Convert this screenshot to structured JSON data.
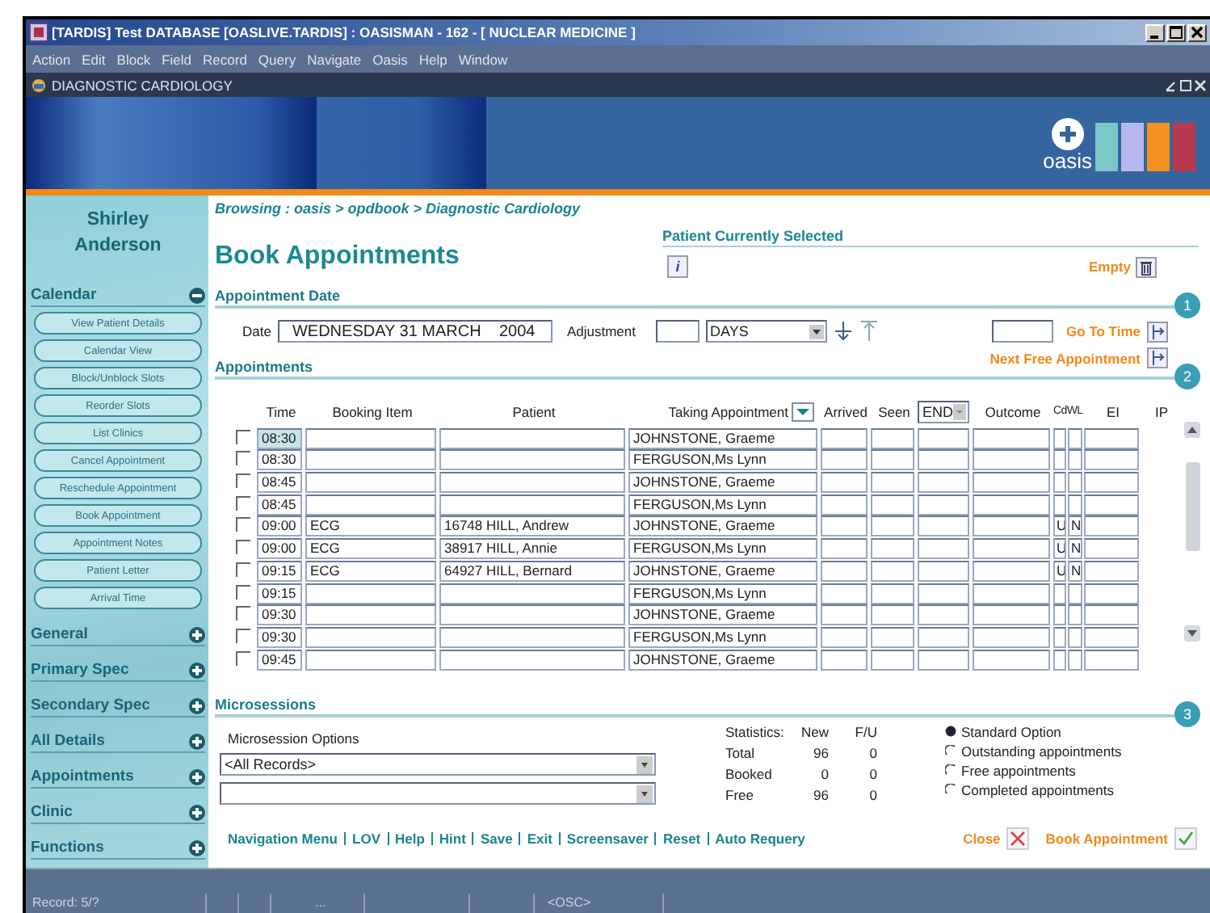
{
  "window": {
    "title": "[TARDIS] Test DATABASE [OASLIVE.TARDIS] : OASISMAN - 162 - [ NUCLEAR MEDICINE ]"
  },
  "menu": [
    "Action",
    "Edit",
    "Block",
    "Field",
    "Record",
    "Query",
    "Navigate",
    "Oasis",
    "Help",
    "Window"
  ],
  "subwindow": {
    "title": "DIAGNOSTIC CARDIOLOGY"
  },
  "logo": {
    "text": "oasis"
  },
  "sidebar": {
    "user": [
      "Shirley",
      "Anderson"
    ],
    "sections": [
      {
        "label": "Calendar",
        "expanded": true,
        "children": [
          "View Patient Details",
          "Calendar View",
          "Block/Unblock Slots",
          "Reorder Slots",
          "List Clinics",
          "Cancel Appointment",
          "Reschedule Appointment",
          "Book Appointment",
          "Appointment Notes",
          "Patient Letter",
          "Arrival Time"
        ]
      },
      {
        "label": "General",
        "expanded": false
      },
      {
        "label": "Primary Spec",
        "expanded": false
      },
      {
        "label": "Secondary Spec",
        "expanded": false
      },
      {
        "label": "All Details",
        "expanded": false
      },
      {
        "label": "Appointments",
        "expanded": false
      },
      {
        "label": "Clinic",
        "expanded": false
      },
      {
        "label": "Functions",
        "expanded": false
      }
    ]
  },
  "breadcrumb": "Browsing : oasis > opdbook > Diagnostic Cardiology",
  "page_title": "Book Appointments",
  "patient_panel": {
    "heading": "Patient Currently Selected",
    "info": "i",
    "empty_label": "Empty"
  },
  "appointment_date": {
    "heading": "Appointment Date",
    "step": "1",
    "date_label": "Date",
    "date_value": "WEDNESDAY 31 MARCH    2004",
    "adjustment_label": "Adjustment",
    "unit": "DAYS",
    "go_to_time": "Go To Time",
    "next_free": "Next Free Appointment"
  },
  "appointments": {
    "heading": "Appointments",
    "step": "2",
    "filter": "END",
    "columns": [
      "Time",
      "Booking Item",
      "Patient",
      "Taking Appointment",
      "Arrived",
      "Seen",
      "Outcome",
      "CdWL",
      "EI",
      "IP"
    ],
    "rows": [
      {
        "checked": false,
        "selected": true,
        "time": "08:30",
        "booking_item": "",
        "patient": "",
        "taking": "JOHNSTONE, Graeme",
        "cd": "",
        "wl": ""
      },
      {
        "checked": false,
        "selected": false,
        "time": "08:30",
        "booking_item": "",
        "patient": "",
        "taking": "FERGUSON,Ms Lynn",
        "cd": "",
        "wl": ""
      },
      {
        "checked": false,
        "selected": false,
        "time": "08:45",
        "booking_item": "",
        "patient": "",
        "taking": "JOHNSTONE, Graeme",
        "cd": "",
        "wl": ""
      },
      {
        "checked": false,
        "selected": false,
        "time": "08:45",
        "booking_item": "",
        "patient": "",
        "taking": "FERGUSON,Ms Lynn",
        "cd": "",
        "wl": ""
      },
      {
        "checked": false,
        "selected": false,
        "time": "09:00",
        "booking_item": "ECG",
        "patient": "16748 HILL, Andrew",
        "taking": "JOHNSTONE, Graeme",
        "cd": "U",
        "wl": "N"
      },
      {
        "checked": false,
        "selected": false,
        "time": "09:00",
        "booking_item": "ECG",
        "patient": "38917 HILL, Annie",
        "taking": "FERGUSON,Ms Lynn",
        "cd": "U",
        "wl": "N"
      },
      {
        "checked": false,
        "selected": false,
        "time": "09:15",
        "booking_item": "ECG",
        "patient": "64927 HILL, Bernard",
        "taking": "JOHNSTONE, Graeme",
        "cd": "U",
        "wl": "N"
      },
      {
        "checked": false,
        "selected": false,
        "time": "09:15",
        "booking_item": "",
        "patient": "",
        "taking": "FERGUSON,Ms Lynn",
        "cd": "",
        "wl": ""
      },
      {
        "checked": false,
        "selected": false,
        "time": "09:30",
        "booking_item": "",
        "patient": "",
        "taking": "JOHNSTONE, Graeme",
        "cd": "",
        "wl": ""
      },
      {
        "checked": false,
        "selected": false,
        "time": "09:30",
        "booking_item": "",
        "patient": "",
        "taking": "FERGUSON,Ms Lynn",
        "cd": "",
        "wl": ""
      },
      {
        "checked": false,
        "selected": false,
        "time": "09:45",
        "booking_item": "",
        "patient": "",
        "taking": "JOHNSTONE, Graeme",
        "cd": "",
        "wl": ""
      }
    ]
  },
  "microsessions": {
    "heading": "Microsessions",
    "step": "3",
    "options_label": "Microsession Options",
    "option_value": "<All Records>",
    "statistics": {
      "label": "Statistics:",
      "columns": [
        "New",
        "F/U"
      ],
      "rows": [
        {
          "label": "Total",
          "new": "96",
          "fu": "0"
        },
        {
          "label": "Booked",
          "new": "0",
          "fu": "0"
        },
        {
          "label": "Free",
          "new": "96",
          "fu": "0"
        }
      ]
    },
    "radios": [
      {
        "label": "Standard Option",
        "selected": true
      },
      {
        "label": "Outstanding appointments",
        "selected": false
      },
      {
        "label": "Free appointments",
        "selected": false
      },
      {
        "label": "Completed appointments",
        "selected": false
      }
    ]
  },
  "nav_links": [
    "Navigation Menu",
    "LOV",
    "Help",
    "Hint",
    "Save",
    "Exit",
    "Screensaver",
    "Reset",
    "Auto Requery"
  ],
  "actions": {
    "close": "Close",
    "book": "Book Appointment"
  },
  "status_bar": {
    "record": "Record: 5/?",
    "field_2": "...",
    "field_3": "<OSC>"
  }
}
